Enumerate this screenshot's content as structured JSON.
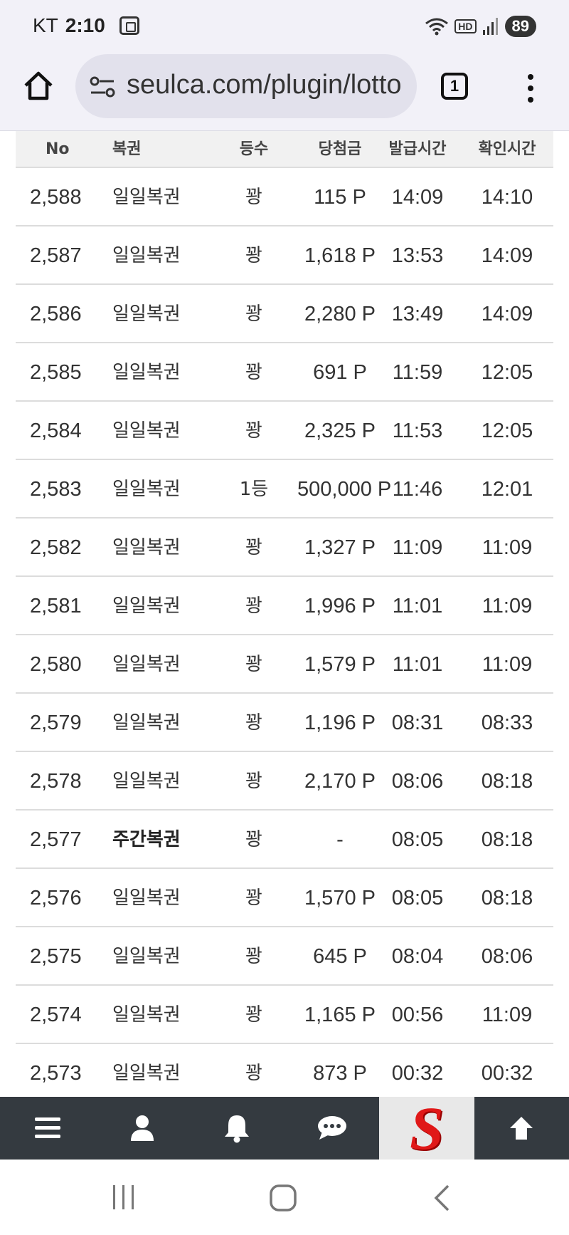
{
  "status_bar": {
    "carrier": "KT",
    "time": "2:10",
    "hd_label": "HD",
    "battery": "89"
  },
  "browser": {
    "url": "seulca.com/plugin/lotto",
    "tab_count": "1"
  },
  "table": {
    "headers": [
      "No",
      "복권",
      "등수",
      "당첨금",
      "발급시간",
      "확인시간"
    ],
    "rows": [
      {
        "no": "2,588",
        "type": "일일복권",
        "rank": "꽝",
        "prize": "115 P",
        "issued": "14:09",
        "checked": "14:10"
      },
      {
        "no": "2,587",
        "type": "일일복권",
        "rank": "꽝",
        "prize": "1,618 P",
        "issued": "13:53",
        "checked": "14:09"
      },
      {
        "no": "2,586",
        "type": "일일복권",
        "rank": "꽝",
        "prize": "2,280 P",
        "issued": "13:49",
        "checked": "14:09"
      },
      {
        "no": "2,585",
        "type": "일일복권",
        "rank": "꽝",
        "prize": "691 P",
        "issued": "11:59",
        "checked": "12:05"
      },
      {
        "no": "2,584",
        "type": "일일복권",
        "rank": "꽝",
        "prize": "2,325 P",
        "issued": "11:53",
        "checked": "12:05"
      },
      {
        "no": "2,583",
        "type": "일일복권",
        "rank": "1등",
        "prize": "500,000 P",
        "issued": "11:46",
        "checked": "12:01"
      },
      {
        "no": "2,582",
        "type": "일일복권",
        "rank": "꽝",
        "prize": "1,327 P",
        "issued": "11:09",
        "checked": "11:09"
      },
      {
        "no": "2,581",
        "type": "일일복권",
        "rank": "꽝",
        "prize": "1,996 P",
        "issued": "11:01",
        "checked": "11:09"
      },
      {
        "no": "2,580",
        "type": "일일복권",
        "rank": "꽝",
        "prize": "1,579 P",
        "issued": "11:01",
        "checked": "11:09"
      },
      {
        "no": "2,579",
        "type": "일일복권",
        "rank": "꽝",
        "prize": "1,196 P",
        "issued": "08:31",
        "checked": "08:33"
      },
      {
        "no": "2,578",
        "type": "일일복권",
        "rank": "꽝",
        "prize": "2,170 P",
        "issued": "08:06",
        "checked": "08:18"
      },
      {
        "no": "2,577",
        "type": "주간복권",
        "rank": "꽝",
        "prize": "-",
        "issued": "08:05",
        "checked": "08:18",
        "bold_type": true
      },
      {
        "no": "2,576",
        "type": "일일복권",
        "rank": "꽝",
        "prize": "1,570 P",
        "issued": "08:05",
        "checked": "08:18"
      },
      {
        "no": "2,575",
        "type": "일일복권",
        "rank": "꽝",
        "prize": "645 P",
        "issued": "08:04",
        "checked": "08:06"
      },
      {
        "no": "2,574",
        "type": "일일복권",
        "rank": "꽝",
        "prize": "1,165 P",
        "issued": "00:56",
        "checked": "11:09"
      },
      {
        "no": "2,573",
        "type": "일일복권",
        "rank": "꽝",
        "prize": "873 P",
        "issued": "00:32",
        "checked": "00:32"
      }
    ]
  },
  "bottom_nav": {
    "items": [
      "menu-icon",
      "user-icon",
      "bell-icon",
      "chat-icon",
      "site-logo",
      "arrow-up-icon"
    ],
    "logo_letter": "S",
    "background": "#343a40",
    "logo_color": "#e01818"
  }
}
